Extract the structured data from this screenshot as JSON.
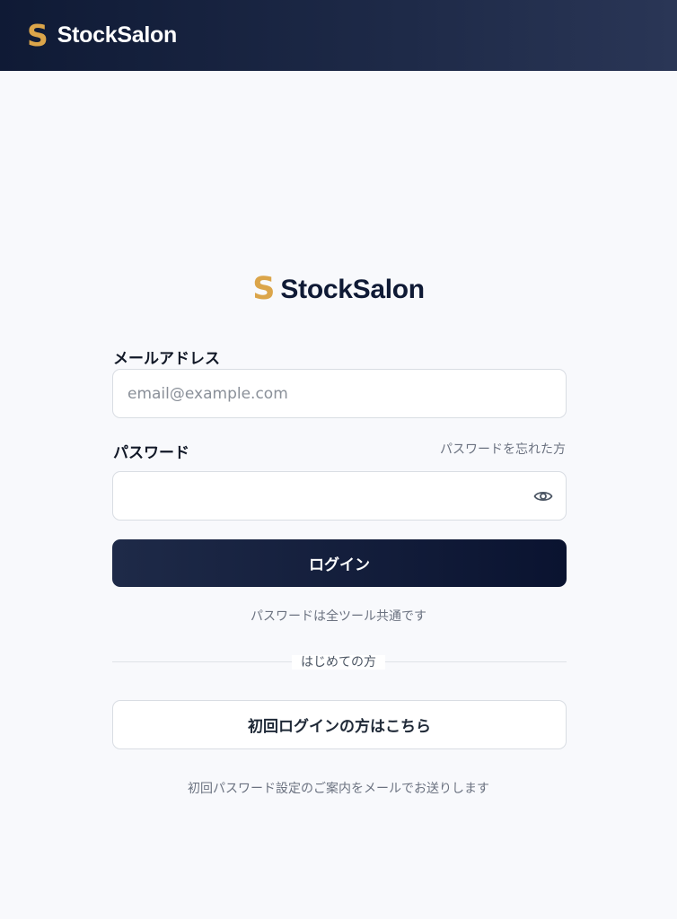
{
  "header": {
    "logo_letter": "S",
    "brand": "StockSalon"
  },
  "login": {
    "logo_letter": "S",
    "brand": "StockSalon",
    "email_label": "メールアドレス",
    "email_placeholder": "email@example.com",
    "email_value": "",
    "password_label": "パスワード",
    "forgot_link": "パスワードを忘れた方",
    "password_value": "",
    "login_button": "ログイン",
    "password_note": "パスワードは全ツール共通です",
    "divider_label": "はじめての方",
    "first_login_button": "初回ログインの方はこちら",
    "first_login_note": "初回パスワード設定のご案内をメールでお送りします"
  },
  "colors": {
    "accent": "#dba54a",
    "navy": "#0f1a35"
  }
}
